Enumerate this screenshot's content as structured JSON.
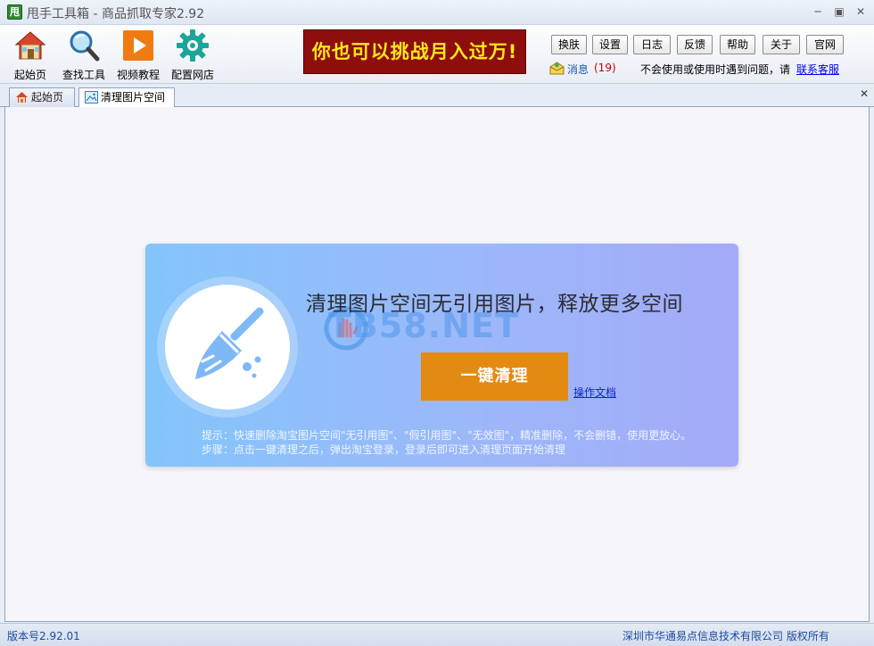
{
  "window": {
    "icon_text": "甩",
    "title": "甩手工具箱 - 商品抓取专家2.92"
  },
  "toolbar": {
    "items": [
      {
        "label": "起始页",
        "icon": "home-icon"
      },
      {
        "label": "查找工具",
        "icon": "magnifier-icon"
      },
      {
        "label": "视频教程",
        "icon": "play-icon"
      },
      {
        "label": "配置网店",
        "icon": "gear-icon"
      }
    ],
    "banner": "你也可以挑战月入过万!",
    "buttons": {
      "skin": "换肤",
      "settings": "设置",
      "log": "日志",
      "feedback": "反馈",
      "help": "帮助",
      "about": "关于",
      "site": "官网"
    },
    "messages": {
      "label": "消息",
      "count": "(19)"
    },
    "help_text": "不会使用或使用时遇到问题，请",
    "help_link": "联系客服"
  },
  "tabs": [
    {
      "label": "起始页"
    },
    {
      "label": "清理图片空间",
      "active": true
    }
  ],
  "card": {
    "title": "清理图片空间无引用图片，释放更多空间",
    "watermark": "TB58.NET",
    "clean_button": "一键清理",
    "doc_link": "操作文档",
    "tip_1": "提示：快速删除淘宝图片空间\"无引用图\"、\"假引用图\"、\"无效图\"，精准删除，不会删错，使用更放心。",
    "tip_2": "步骤：点击一键清理之后，弹出淘宝登录，登录后即可进入清理页面开始清理"
  },
  "status": {
    "version": "版本号2.92.01",
    "copyright": "深圳市华通易点信息技术有限公司 版权所有"
  },
  "colors": {
    "accent_button": "#e38a12",
    "banner_bg": "#8e0d0d",
    "banner_text": "#ffe81a",
    "card_left": "#84c5fb",
    "card_right": "#a4aaf8"
  }
}
